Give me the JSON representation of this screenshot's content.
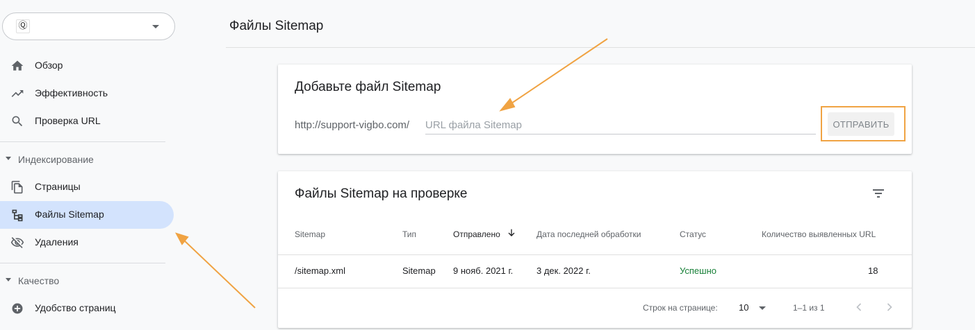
{
  "sidebar": {
    "property_logo": "Ⓠ",
    "items_top": [
      {
        "label": "Обзор",
        "icon": "home-icon"
      },
      {
        "label": "Эффективность",
        "icon": "trending-up-icon"
      },
      {
        "label": "Проверка URL",
        "icon": "search-icon"
      }
    ],
    "section_indexing": "Индексирование",
    "items_indexing": [
      {
        "label": "Страницы",
        "icon": "pages-icon"
      },
      {
        "label": "Файлы Sitemap",
        "icon": "sitemap-icon",
        "active": true
      },
      {
        "label": "Удаления",
        "icon": "visibility-off-icon"
      }
    ],
    "section_quality": "Качество",
    "items_quality": [
      {
        "label": "Удобство страниц",
        "icon": "add-circle-icon"
      }
    ]
  },
  "header": {
    "title": "Файлы Sitemap"
  },
  "add_card": {
    "title": "Добавьте файл Sitemap",
    "url_prefix": "http://support-vigbo.com/",
    "input_placeholder": "URL файла Sitemap",
    "input_value": "",
    "submit_label": "ОТПРАВИТЬ"
  },
  "list_card": {
    "title": "Файлы Sitemap на проверке",
    "columns": [
      "Sitemap",
      "Тип",
      "Отправлено",
      "Дата последней обработки",
      "Статус",
      "Количество выявленных URL"
    ],
    "rows": [
      {
        "sitemap": "/sitemap.xml",
        "type": "Sitemap",
        "submitted": "9 нояб. 2021 г.",
        "last_read": "3 дек. 2022 г.",
        "status": "Успешно",
        "urls": "18"
      }
    ],
    "pager": {
      "rows_label": "Строк на странице:",
      "rows_value": "10",
      "range": "1–1 из 1"
    }
  },
  "colors": {
    "accent_active": "#d3e3fd",
    "status_ok": "#188038",
    "annotation": "#f0a343"
  }
}
